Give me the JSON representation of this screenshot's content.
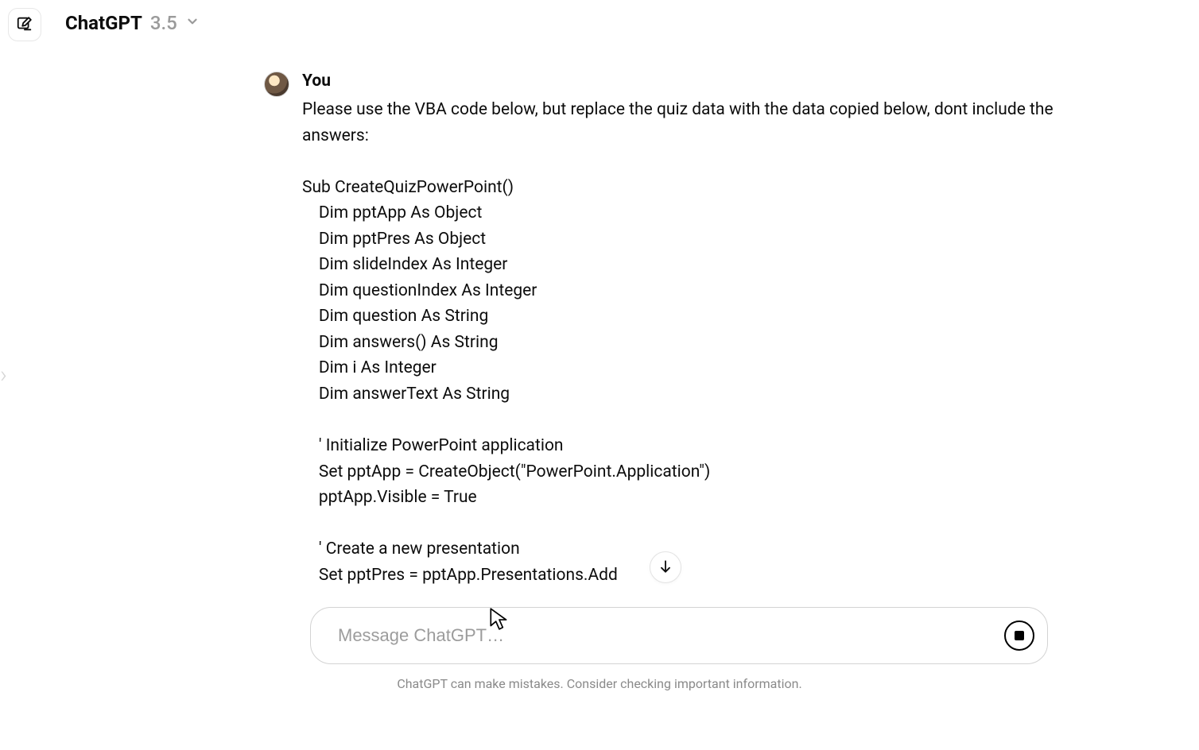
{
  "header": {
    "model_name": "ChatGPT",
    "model_version": "3.5"
  },
  "conversation": {
    "user_message": {
      "sender_label": "You",
      "text": "Please use the VBA code below, but replace the quiz data with the data copied below, dont include the answers:\n\nSub CreateQuizPowerPoint()\n    Dim pptApp As Object\n    Dim pptPres As Object\n    Dim slideIndex As Integer\n    Dim questionIndex As Integer\n    Dim question As String\n    Dim answers() As String\n    Dim i As Integer\n    Dim answerText As String\n\n    ' Initialize PowerPoint application\n    Set pptApp = CreateObject(\"PowerPoint.Application\")\n    pptApp.Visible = True\n\n    ' Create a new presentation\n    Set pptPres = pptApp.Presentations.Add"
    }
  },
  "composer": {
    "placeholder": "Message ChatGPT…",
    "value": ""
  },
  "footer": {
    "note": "ChatGPT can make mistakes. Consider checking important information."
  },
  "icons": {
    "new_chat": "pencil-square-icon",
    "chevron_down": "chevron-down-icon",
    "arrow_down": "arrow-down-icon",
    "stop": "stop-icon"
  }
}
